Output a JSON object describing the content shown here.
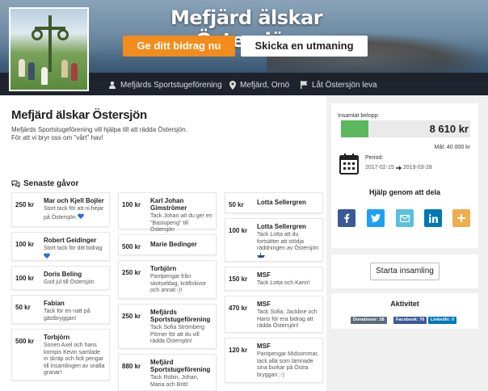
{
  "hero": {
    "title": "Mefjärd älskar Östersjön",
    "contribute_label": "Ge ditt bidrag nu",
    "challenge_label": "Skicka en utmaning",
    "organizer": "Mefjärds Sportstugeförening",
    "location": "Mefjärd, Ornö",
    "cause": "Låt Östersjön leva"
  },
  "campaign": {
    "title": "Mefjärd älskar Östersjön",
    "description_line1": "Mefjärds Sportstugeförening vill hjälpa till att rädda Östersjön.",
    "description_line2": "För att vi bryr oss om \"vårt\" hav!"
  },
  "recent": {
    "heading": "Senaste gåvor",
    "columns": [
      [
        {
          "amount": "250 kr",
          "name": "Mar och Kjell Bojler",
          "message": "Stort tack för att ni hejar på Östersjön",
          "icon": "heart-icon"
        },
        {
          "amount": "100 kr",
          "name": "Robert Geidinger",
          "message": "Stort tack för ditt bidrag",
          "icon": "heart-icon"
        },
        {
          "amount": "100 kr",
          "name": "Doris Beling",
          "message": "God jul till Östersjön",
          "icon": ""
        },
        {
          "amount": "50 kr",
          "name": "Fabian",
          "message": "Tack för en natt på gästbryggan!",
          "icon": ""
        },
        {
          "amount": "500 kr",
          "name": "Torbjörn",
          "message": "Sonen Axel och hans kompis Kevin samlade in skräp och fick pengar till insamlingen av snälla granar!",
          "icon": ""
        }
      ],
      [
        {
          "amount": "100 kr",
          "name": "Karl Johan Gimströmer",
          "message": "Tack Johan att du ger en \"Bastupeng\" till Östersjön",
          "icon": ""
        },
        {
          "amount": "500 kr",
          "name": "Marie Bedinger",
          "message": "",
          "icon": ""
        },
        {
          "amount": "250 kr",
          "name": "Torbjörn",
          "message": "Pantpengar från skotseldag, kräftskivor och annat:-)!",
          "icon": ""
        },
        {
          "amount": "250 kr",
          "name": "Mefjärds Sportstugeförening",
          "message": "Tack Sofia Strömberg Pörner för att du vill rädda Östersjön!",
          "icon": ""
        },
        {
          "amount": "880 kr",
          "name": "Mefjärd Sportstugeförening",
          "message": "Tack Robin, Johan, Maria och Britt!",
          "icon": ""
        }
      ],
      [
        {
          "amount": "50 kr",
          "name": "Lotta Sellergren",
          "message": "",
          "icon": ""
        },
        {
          "amount": "100 kr",
          "name": "Lotta Sellergren",
          "message": "Tack Lotta att du fortsätter att stödja räddningen av Östersjön",
          "icon": "boat-icon"
        },
        {
          "amount": "150 kr",
          "name": "MSF",
          "message": "Tack Lotta och Karin!",
          "icon": ""
        },
        {
          "amount": "470 kr",
          "name": "MSF",
          "message": "Tack Sofia, Jackline och Hans för era bidrag att rädda Östersjön!",
          "icon": ""
        },
        {
          "amount": "120 kr",
          "name": "MSF",
          "message": "Pantpengar Midsommar, tack alla som lämnade sina burkar på Östra bryggan ;-)",
          "icon": ""
        }
      ]
    ]
  },
  "fundraising": {
    "collected_label": "Insamlat belopp:",
    "amount": "8 610 kr",
    "progress_fraction": 0.215,
    "goal_label": "Mål: 40 000 kr",
    "period_label": "Period:",
    "period_start": "2017-02-15",
    "period_end": "2019-03-28"
  },
  "share": {
    "title": "Hjälp genom att dela",
    "buttons": [
      {
        "name": "facebook-share-button",
        "icon": "facebook-icon",
        "color": "#3b5998"
      },
      {
        "name": "twitter-share-button",
        "icon": "twitter-icon",
        "color": "#1da1f2"
      },
      {
        "name": "email-share-button",
        "icon": "email-icon",
        "color": "#5bc0de"
      },
      {
        "name": "linkedin-share-button",
        "icon": "linkedin-icon",
        "color": "#0077b5"
      },
      {
        "name": "more-share-button",
        "icon": "plus-icon",
        "color": "#f0ad4e"
      }
    ]
  },
  "start": {
    "label": "Starta insamling"
  },
  "activity": {
    "title": "Aktivitet",
    "badges": [
      {
        "label": "Donationer: 28",
        "color": "#5a6b7c"
      },
      {
        "label": "Facebook: 76",
        "color": "#3b5998"
      },
      {
        "label": "LinkedIn: 0",
        "color": "#0077b5"
      }
    ]
  },
  "colors": {
    "accent": "#f28c1c",
    "progress": "#5cb85c"
  }
}
